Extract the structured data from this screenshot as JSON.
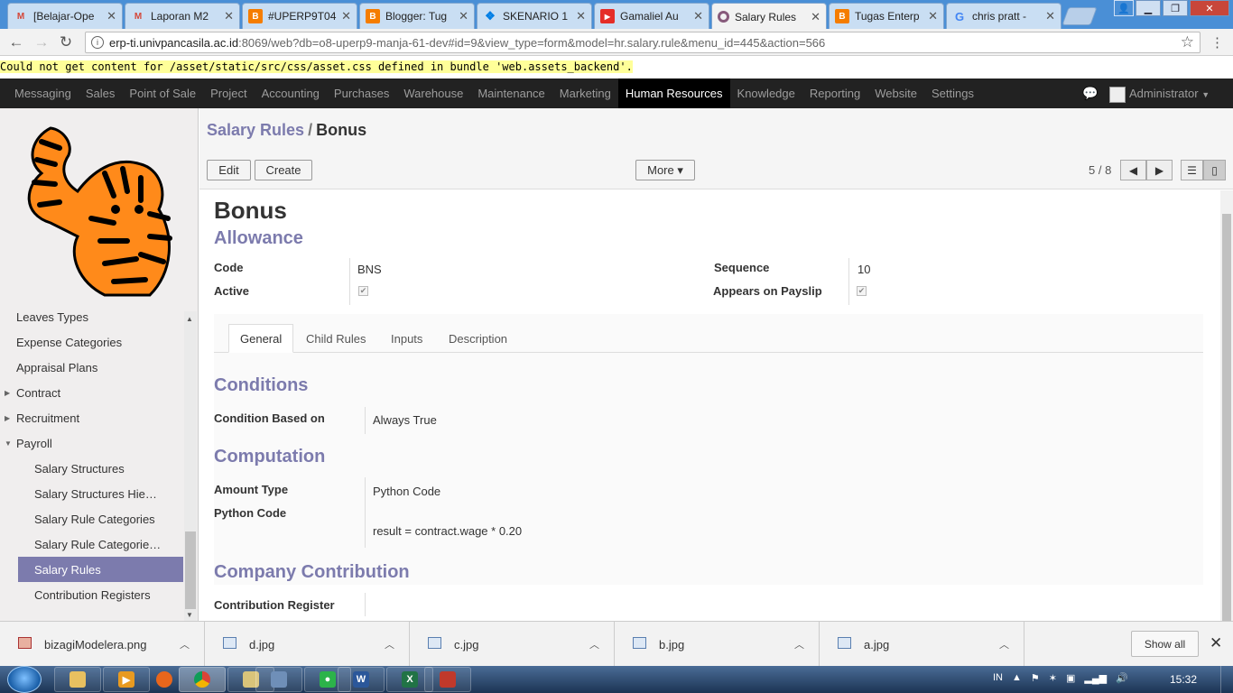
{
  "browser": {
    "tabs": [
      {
        "label": "[Belajar-Ope",
        "icon": "gmail-icon",
        "color": "#d44638"
      },
      {
        "label": "Laporan M2",
        "icon": "gmail-icon",
        "color": "#d44638"
      },
      {
        "label": "#UPERP9T04",
        "icon": "blogger-icon",
        "color": "#f57d00"
      },
      {
        "label": "Blogger: Tug",
        "icon": "blogger-icon",
        "color": "#f57d00"
      },
      {
        "label": "SKENARIO 1",
        "icon": "dropbox-icon",
        "color": "#007ee5"
      },
      {
        "label": "Gamaliel Au",
        "icon": "youtube-icon",
        "color": "#e52d27"
      },
      {
        "label": "Salary Rules",
        "icon": "odoo-icon",
        "color": "#875a7b",
        "active": true
      },
      {
        "label": "Tugas Enterp",
        "icon": "blogger-icon",
        "color": "#f57d00"
      },
      {
        "label": "chris pratt -",
        "icon": "google-icon",
        "color": "#4285f4"
      }
    ],
    "url_host": "erp-ti.univpancasila.ac.id",
    "url_path": ":8069/web?db=o8-uperp9-manja-61-dev#id=9&view_type=form&model=hr.salary.rule&menu_id=445&action=566"
  },
  "warning": "Could not get content for /asset/static/src/css/asset.css defined in bundle 'web.assets_backend'.",
  "topmenu": {
    "items": [
      "Messaging",
      "Sales",
      "Point of Sale",
      "Project",
      "Accounting",
      "Purchases",
      "Warehouse",
      "Maintenance",
      "Marketing",
      "Human Resources",
      "Knowledge",
      "Reporting",
      "Website",
      "Settings"
    ],
    "active": "Human Resources",
    "user": "Administrator"
  },
  "sidebar": {
    "items": [
      {
        "label": "Leaves Types",
        "level": 0
      },
      {
        "label": "Expense Categories",
        "level": 0
      },
      {
        "label": "Appraisal Plans",
        "level": 0
      },
      {
        "label": "Contract",
        "level": 0,
        "caret": "right"
      },
      {
        "label": "Recruitment",
        "level": 0,
        "caret": "right"
      },
      {
        "label": "Payroll",
        "level": 0,
        "caret": "down"
      },
      {
        "label": "Salary Structures",
        "level": 1
      },
      {
        "label": "Salary Structures Hie…",
        "level": 1
      },
      {
        "label": "Salary Rule Categories",
        "level": 1
      },
      {
        "label": "Salary Rule Categorie…",
        "level": 1
      },
      {
        "label": "Salary Rules",
        "level": 1,
        "selected": true
      },
      {
        "label": "Contribution Registers",
        "level": 1
      }
    ]
  },
  "controlpanel": {
    "breadcrumb_parent": "Salary Rules",
    "breadcrumb_sep": "/",
    "breadcrumb_current": "Bonus",
    "edit_label": "Edit",
    "create_label": "Create",
    "more_label": "More ▾",
    "pager": "5 / 8"
  },
  "form": {
    "name": "Bonus",
    "category": "Allowance",
    "code_label": "Code",
    "code_value": "BNS",
    "active_label": "Active",
    "active_checked": true,
    "sequence_label": "Sequence",
    "sequence_value": "10",
    "payslip_label": "Appears on Payslip",
    "payslip_checked": true,
    "tabs": [
      "General",
      "Child Rules",
      "Inputs",
      "Description"
    ],
    "active_tab": "General",
    "conditions_title": "Conditions",
    "condition_label": "Condition Based on",
    "condition_value": "Always True",
    "computation_title": "Computation",
    "amount_type_label": "Amount Type",
    "amount_type_value": "Python Code",
    "python_code_label": "Python Code",
    "python_code_value": "result = contract.wage * 0.20",
    "company_title": "Company Contribution",
    "contribution_label": "Contribution Register",
    "contribution_value": ""
  },
  "downloads": {
    "items": [
      "bizagiModelera.png",
      "d.jpg",
      "c.jpg",
      "b.jpg",
      "a.jpg"
    ],
    "show_all": "Show all"
  },
  "taskbar": {
    "lang": "IN",
    "time": "15:32"
  },
  "colors": {
    "odoo_accent": "#7c7bad",
    "topbar": "#222222"
  }
}
